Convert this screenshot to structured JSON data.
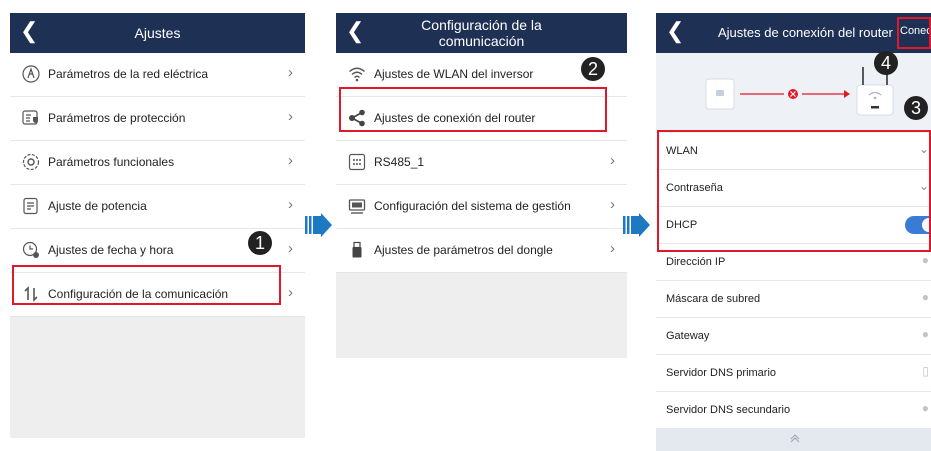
{
  "screen1": {
    "title": "Ajustes",
    "items": [
      {
        "label": "Parámetros de la red eléctrica"
      },
      {
        "label": "Parámetros de protección"
      },
      {
        "label": "Parámetros funcionales"
      },
      {
        "label": "Ajuste de potencia"
      },
      {
        "label": "Ajustes de fecha y hora"
      },
      {
        "label": "Configuración de la comunicación"
      }
    ],
    "badge": "1"
  },
  "screen2": {
    "title_line1": "Configuración de la",
    "title_line2": "comunicación",
    "items": [
      {
        "label": "Ajustes de WLAN del inversor"
      },
      {
        "label": "Ajustes de conexión del router"
      },
      {
        "label": "RS485_1"
      },
      {
        "label": "Configuración del sistema de gestión"
      },
      {
        "label": "Ajustes de parámetros del dongle"
      }
    ],
    "badge": "2"
  },
  "screen3": {
    "title": "Ajustes de conexión del router",
    "connect_label": "Conecta",
    "badge_connect": "4",
    "badge_fields": "3",
    "rows": [
      {
        "label": "WLAN",
        "value": "⌄"
      },
      {
        "label": "Contraseña",
        "value": "⌄"
      },
      {
        "label": "DHCP",
        "dhcp_on": true
      },
      {
        "label": "Dirección IP",
        "value": "●"
      },
      {
        "label": "Máscara de subred",
        "value": "●"
      },
      {
        "label": "Gateway",
        "value": "●"
      },
      {
        "label": "Servidor DNS primario",
        "value": "▯"
      },
      {
        "label": "Servidor DNS secundario",
        "value": "●"
      }
    ],
    "colors": {
      "accent": "#3a7bd5",
      "error": "#e0192a",
      "header": "#1e3155"
    }
  },
  "icons": {
    "back": "chevron-left-icon",
    "row_chevron": "chevron-right-icon",
    "flow": "arrow-right-icon"
  }
}
